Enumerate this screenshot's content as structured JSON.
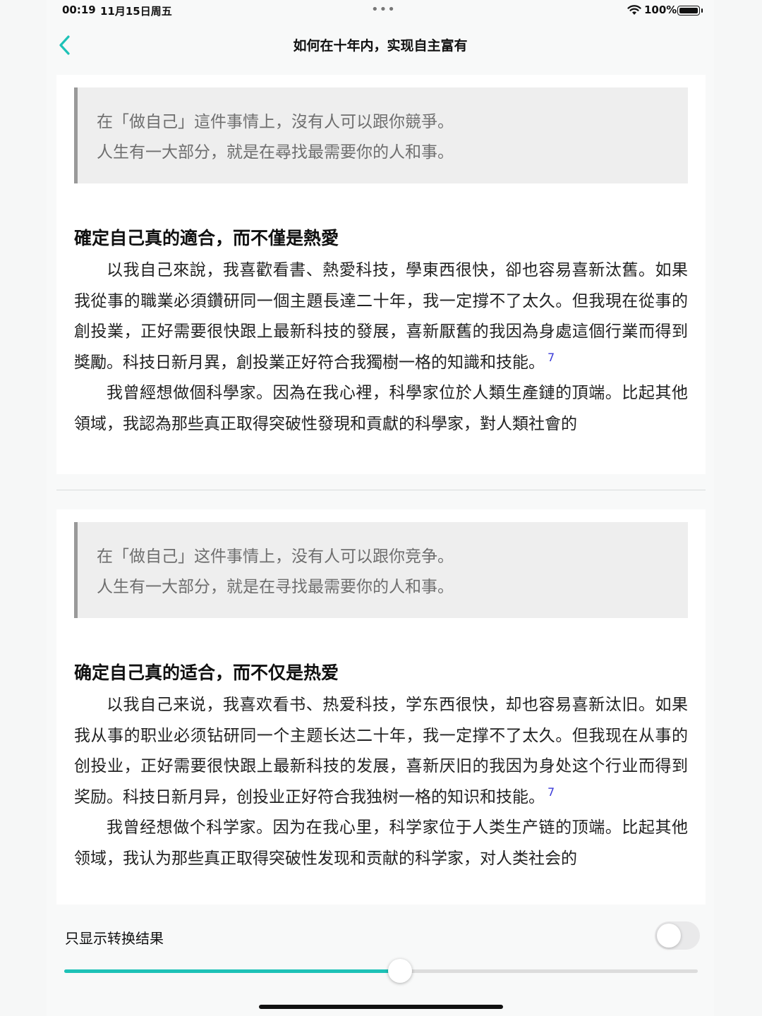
{
  "status_bar": {
    "time": "00:19",
    "date": "11月15日周五",
    "dots": "•••",
    "battery": "100%"
  },
  "nav": {
    "title": "如何在十年内，实现自主富有",
    "back_icon": "chevron-left-icon",
    "accent_color": "#1ec2b7"
  },
  "original": {
    "quote": [
      "在「做自己」這件事情上，沒有人可以跟你競爭。",
      "人生有一大部分，就是在尋找最需要你的人和事。"
    ],
    "heading": "確定自己真的適合，而不僅是熱愛",
    "paragraph1": "以我自己來說，我喜歡看書、熱愛科技，學東西很快，卻也容易喜新汰舊。如果我從事的職業必須鑽研同一個主題長達二十年，我一定撐不了太久。但我現在從事的創投業，正好需要很快跟上最新科技的發展，喜新厭舊的我因為身處這個行業而得到獎勵。科技日新月異，創投業正好符合我獨樹一格的知識和技能。",
    "footnote": "7",
    "paragraph2": "我曾經想做個科學家。因為在我心裡，科學家位於人類生產鏈的頂端。比起其他領域，我認為那些真正取得突破性發現和貢獻的科學家，對人類社會的"
  },
  "converted": {
    "quote": [
      "在「做自己」这件事情上，没有人可以跟你竞争。",
      "人生有一大部分，就是在寻找最需要你的人和事。"
    ],
    "heading": "确定自己真的适合，而不仅是热爱",
    "paragraph1": "以我自己来说，我喜欢看书、热爱科技，学东西很快，却也容易喜新汰旧。如果我从事的职业必须钻研同一个主题长达二十年，我一定撑不了太久。但我现在从事的创投业，正好需要很快跟上最新科技的发展，喜新厌旧的我因为身处这个行业而得到奖励。科技日新月异，创投业正好符合我独树一格的知识和技能。",
    "footnote": "7",
    "paragraph2": "我曾经想做个科学家。因为在我心里，科学家位于人类生产链的顶端。比起其他领域，我认为那些真正取得突破性发现和贡献的科学家，对人类社会的"
  },
  "controls": {
    "toggle_label": "只显示转换结果",
    "toggle_on": false,
    "slider_value": 0.53
  }
}
